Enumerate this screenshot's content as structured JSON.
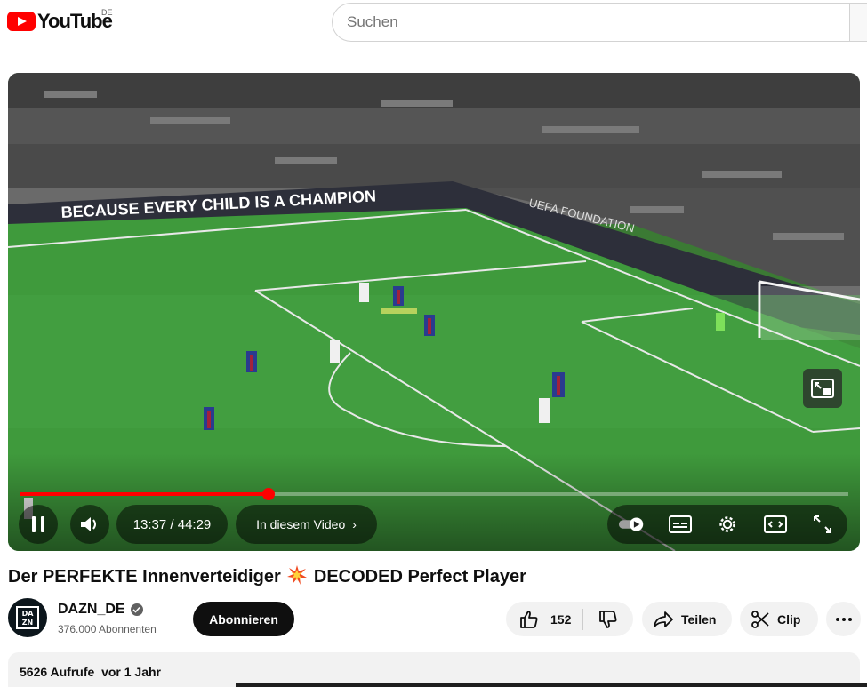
{
  "header": {
    "logo_text": "YouTube",
    "country_code": "DE",
    "search_placeholder": "Suchen"
  },
  "player": {
    "current_time": "13:37",
    "duration": "44:29",
    "time_display": "13:37 / 44:29",
    "progress_fraction": 0.3,
    "chapter_label": "In diesem Video",
    "stadium_banner_1": "BECAUSE EVERY CHILD IS A CHAMPION",
    "stadium_banner_2": "UEFA FOUNDATION"
  },
  "video": {
    "title_part1": "Der PERFEKTE Innenverteidiger",
    "title_part2": "DECODED Perfect Player"
  },
  "channel": {
    "name": "DAZN_DE",
    "avatar_text": "DAZN",
    "subscribers": "376.000 Abonnenten",
    "subscribe_label": "Abonnieren"
  },
  "actions": {
    "like_count": "152",
    "share_label": "Teilen",
    "clip_label": "Clip"
  },
  "description": {
    "views": "5626 Aufrufe",
    "age": "vor 1 Jahr"
  },
  "colors": {
    "brand_red": "#ff0000",
    "text_primary": "#0f0f0f",
    "text_secondary": "#606060",
    "chip_bg": "#f2f2f2"
  }
}
